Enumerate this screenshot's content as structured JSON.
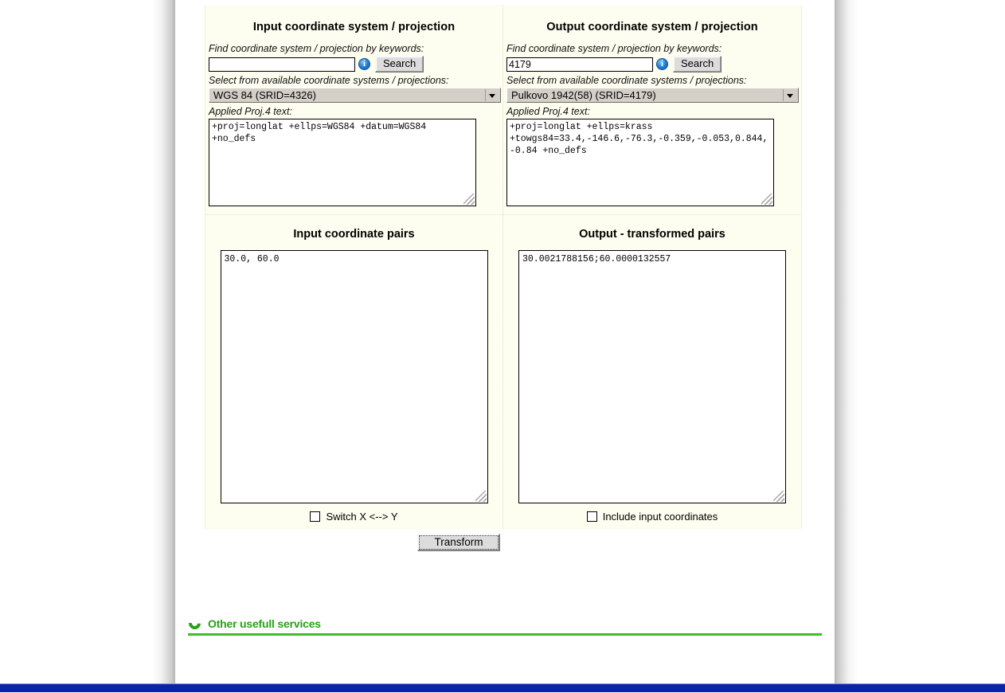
{
  "input_panel": {
    "title": "Input coordinate system / projection",
    "keyword_label": "Find coordinate system / projection by keywords:",
    "keyword_value": "",
    "keyword_placeholder": "",
    "info_icon": "info-icon",
    "search_label": "Search",
    "select_label": "Select from available coordinate systems / projections:",
    "selected_system": "WGS 84 (SRID=4326)",
    "proj4_label": "Applied Proj.4 text:",
    "proj4_text": "+proj=longlat +ellps=WGS84 +datum=WGS84 +no_defs"
  },
  "output_panel": {
    "title": "Output coordinate system / projection",
    "keyword_label": "Find coordinate system / projection by keywords:",
    "keyword_value": "4179",
    "keyword_placeholder": "",
    "info_icon": "info-icon",
    "search_label": "Search",
    "select_label": "Select from available coordinate systems / projections:",
    "selected_system": "Pulkovo 1942(58) (SRID=4179)",
    "proj4_label": "Applied Proj.4 text:",
    "proj4_text": "+proj=longlat +ellps=krass +towgs84=33.4,-146.6,-76.3,-0.359,-0.053,0.844,-0.84 +no_defs"
  },
  "input_pairs": {
    "title": "Input coordinate pairs",
    "value": "30.0, 60.0",
    "checkbox_label": "Switch X <--> Y",
    "checkbox_checked": false
  },
  "output_pairs": {
    "title": "Output - transformed pairs",
    "value": "30.0021788156;60.0000132557",
    "checkbox_label": "Include input coordinates",
    "checkbox_checked": false
  },
  "actions": {
    "transform_label": "Transform"
  },
  "services": {
    "icon": "green-crescent-icon",
    "title": "Other usefull services"
  },
  "colors": {
    "panel_bg": "#fdfdf0",
    "accent_green": "#27a116",
    "rule_green": "#3bc023",
    "bottom_bar_blue": "#0b23a8",
    "info_blue": "#2b86d8"
  }
}
